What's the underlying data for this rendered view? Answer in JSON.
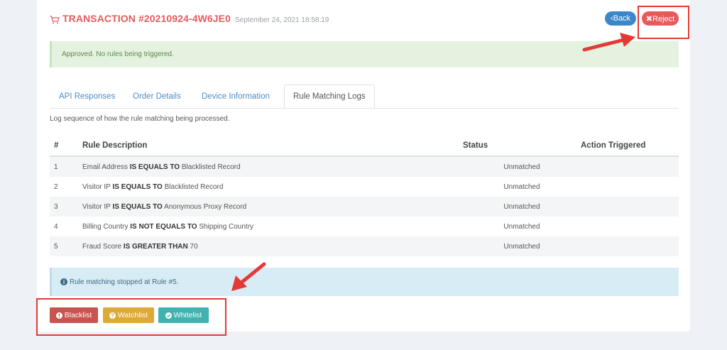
{
  "transaction": {
    "title": "TRANSACTION #20210924-4W6JE0",
    "date": "September 24, 2021 18:58:19"
  },
  "header_buttons": {
    "back_label": "‹Back",
    "reject_label": "✖Reject"
  },
  "alert_success": "Approved. No rules being triggered.",
  "tabs": [
    {
      "label": "API Responses",
      "active": false
    },
    {
      "label": "Order Details",
      "active": false
    },
    {
      "label": "Device Information",
      "active": false
    },
    {
      "label": "Rule Matching Logs",
      "active": true
    }
  ],
  "log_description": "Log sequence of how the rule matching being processed.",
  "table": {
    "headers": [
      "#",
      "Rule Description",
      "Status",
      "Action Triggered"
    ],
    "rows": [
      {
        "num": "1",
        "subject": "Email Address",
        "operator": "IS EQUALS TO",
        "target": "Blacklisted Record",
        "status": "Unmatched",
        "action": ""
      },
      {
        "num": "2",
        "subject": "Visitor IP",
        "operator": "IS EQUALS TO",
        "target": "Blacklisted Record",
        "status": "Unmatched",
        "action": ""
      },
      {
        "num": "3",
        "subject": "Visitor IP",
        "operator": "IS EQUALS TO",
        "target": "Anonymous Proxy Record",
        "status": "Unmatched",
        "action": ""
      },
      {
        "num": "4",
        "subject": "Billing Country",
        "operator": "IS NOT EQUALS TO",
        "target": "Shipping Country",
        "status": "Unmatched",
        "action": ""
      },
      {
        "num": "5",
        "subject": "Fraud Score",
        "operator": "IS GREATER THAN",
        "target": "70",
        "status": "Unmatched",
        "action": ""
      }
    ]
  },
  "alert_info": "Rule matching stopped at Rule #5.",
  "action_buttons": {
    "blacklist": "Blacklist",
    "watchlist": "Watchlist",
    "whitelist": "Whitelist"
  },
  "icons": {
    "title": "shopping-cart-icon",
    "info": "info-circle-icon",
    "blacklist": "exclamation-circle-icon",
    "watchlist": "question-circle-icon",
    "whitelist": "check-circle-icon"
  },
  "colors": {
    "title": "#e05d5d",
    "back": "#3b87c8",
    "reject": "#e85a5a",
    "blacklist": "#c9534f",
    "watchlist": "#dcaa35",
    "whitelist": "#3fb3ae",
    "annotation": "#e53935"
  }
}
